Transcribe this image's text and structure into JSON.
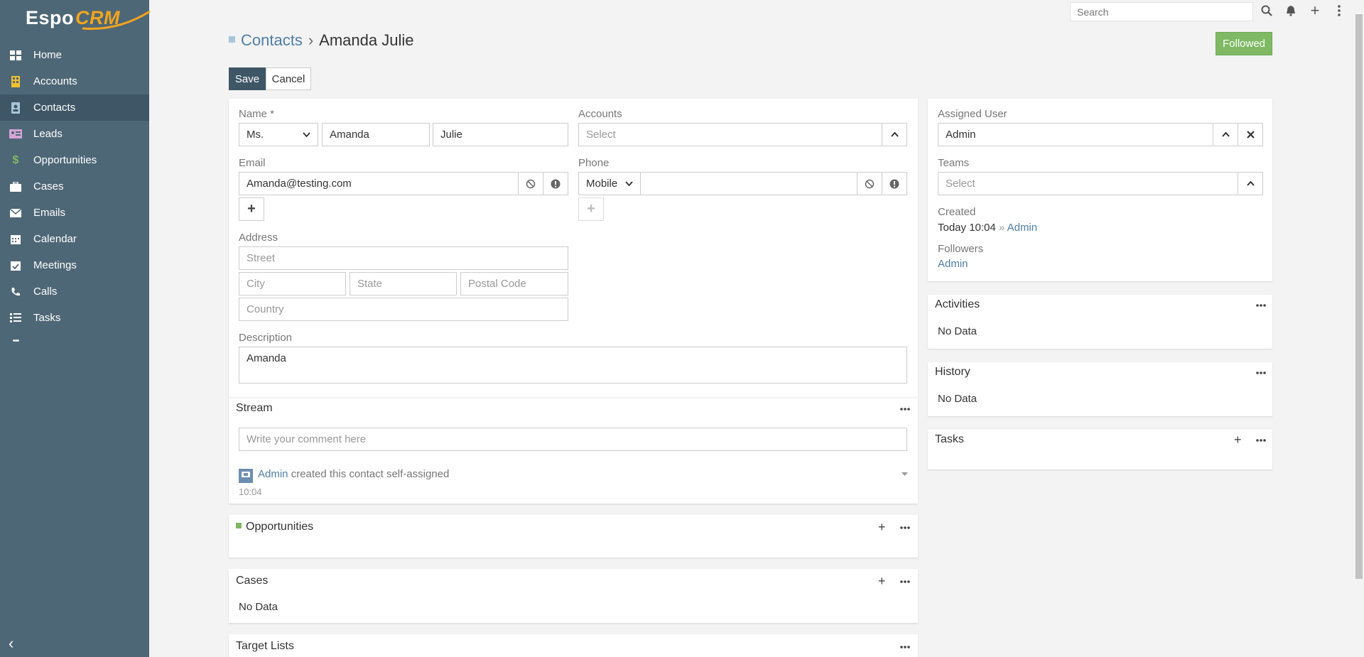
{
  "app": {
    "logo_text": "Espo",
    "logo_accent": "CRM"
  },
  "sidebar": {
    "items": [
      {
        "label": "Home",
        "icon": "dashboard-icon"
      },
      {
        "label": "Accounts",
        "icon": "building-icon"
      },
      {
        "label": "Contacts",
        "icon": "address-book-icon",
        "active": true
      },
      {
        "label": "Leads",
        "icon": "id-card-icon"
      },
      {
        "label": "Opportunities",
        "icon": "dollar-icon"
      },
      {
        "label": "Cases",
        "icon": "briefcase-icon"
      },
      {
        "label": "Emails",
        "icon": "envelope-icon"
      },
      {
        "label": "Calendar",
        "icon": "calendar-icon"
      },
      {
        "label": "Meetings",
        "icon": "calendar-check-icon"
      },
      {
        "label": "Calls",
        "icon": "phone-icon"
      },
      {
        "label": "Tasks",
        "icon": "tasks-icon"
      }
    ],
    "more": "•••",
    "collapse": "‹"
  },
  "topbar": {
    "search_placeholder": "Search"
  },
  "header": {
    "parent": "Contacts",
    "separator": "›",
    "title": "Amanda Julie",
    "followed": "Followed"
  },
  "actions": {
    "save": "Save",
    "cancel": "Cancel"
  },
  "form": {
    "name_label": "Name *",
    "salutation": "Ms.",
    "first_name": "Amanda",
    "last_name": "Julie",
    "accounts_label": "Accounts",
    "accounts_placeholder": "Select",
    "email_label": "Email",
    "email_value": "Amanda@testing.com",
    "phone_label": "Phone",
    "phone_type": "Mobile",
    "phone_value": "",
    "address_label": "Address",
    "street_placeholder": "Street",
    "city_placeholder": "City",
    "state_placeholder": "State",
    "postal_placeholder": "Postal Code",
    "country_placeholder": "Country",
    "description_label": "Description",
    "description_value": "Amanda"
  },
  "stream": {
    "title": "Stream",
    "comment_placeholder": "Write your comment here",
    "entry_user": "Admin",
    "entry_text": "created this contact self-assigned",
    "entry_time": "10:04"
  },
  "panels": {
    "opportunities": "Opportunities",
    "cases": "Cases",
    "cases_nodata": "No Data",
    "target_lists": "Target Lists"
  },
  "side": {
    "assigned_label": "Assigned User",
    "assigned_value": "Admin",
    "teams_label": "Teams",
    "teams_placeholder": "Select",
    "created_label": "Created",
    "created_value": "Today 10:04",
    "created_sep": "»",
    "created_by": "Admin",
    "followers_label": "Followers",
    "followers_value": "Admin",
    "activities": "Activities",
    "activities_nodata": "No Data",
    "history": "History",
    "history_nodata": "No Data",
    "tasks": "Tasks"
  },
  "colors": {
    "sidebar": "#4e6776",
    "active": "#3e5666",
    "accent": "#4f7ea6",
    "followed": "#7fb964"
  }
}
